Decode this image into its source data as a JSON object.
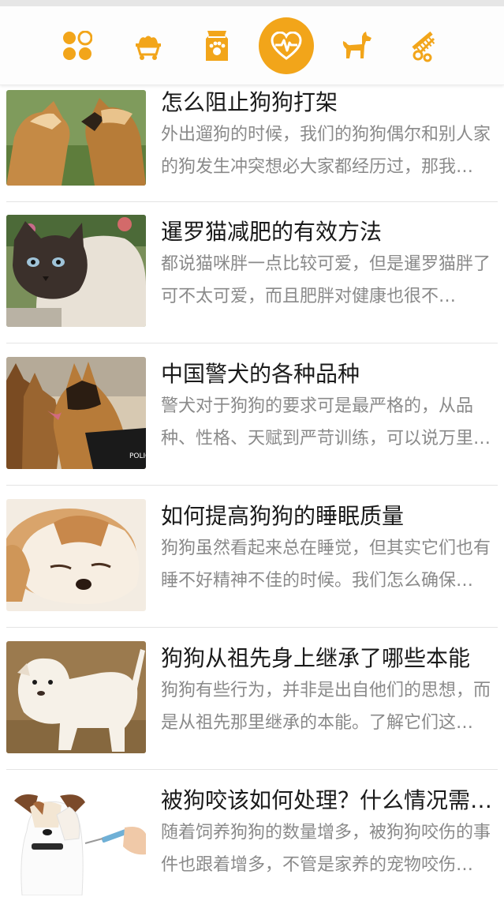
{
  "nav": {
    "accent": "#f2a51a",
    "icons": [
      {
        "name": "grid-icon",
        "active": false
      },
      {
        "name": "pet-cart-icon",
        "active": false
      },
      {
        "name": "pet-food-bag-icon",
        "active": false
      },
      {
        "name": "heart-pulse-icon",
        "active": true
      },
      {
        "name": "dog-icon",
        "active": false
      },
      {
        "name": "grooming-comb-icon",
        "active": false
      }
    ]
  },
  "articles": [
    {
      "title": "怎么阻止狗狗打架",
      "desc": "外出遛狗的时候，我们的狗狗偶尔和别人家的狗发生冲突想必大家都经历过，那我…",
      "image": "fighting-puppies-photo"
    },
    {
      "title": "暹罗猫减肥的有效方法",
      "desc": "都说猫咪胖一点比较可爱，但是暹罗猫胖了可不太可爱，而且肥胖对健康也很不…",
      "image": "siamese-cat-photo"
    },
    {
      "title": "中国警犬的各种品种",
      "desc": "警犬对于狗狗的要求可是最严格的，从品种、性格、天赋到严苛训练，可以说万里…",
      "image": "police-dogs-photo"
    },
    {
      "title": "如何提高狗狗的睡眠质量",
      "desc": "狗狗虽然看起来总在睡觉，但其实它们也有睡不好精神不佳的时候。我们怎么确保…",
      "image": "sleeping-puppy-photo"
    },
    {
      "title": "狗狗从祖先身上继承了哪些本能",
      "desc": "狗狗有些行为，并非是出自他们的思想，而是从祖先那里继承的本能。了解它们这…",
      "image": "white-puppy-photo"
    },
    {
      "title": "被狗咬该如何处理？什么情况需…",
      "desc": "随着饲养狗狗的数量增多，被狗狗咬伤的事件也跟着增多，不管是家养的宠物咬伤…",
      "image": "dog-vaccine-photo"
    }
  ]
}
